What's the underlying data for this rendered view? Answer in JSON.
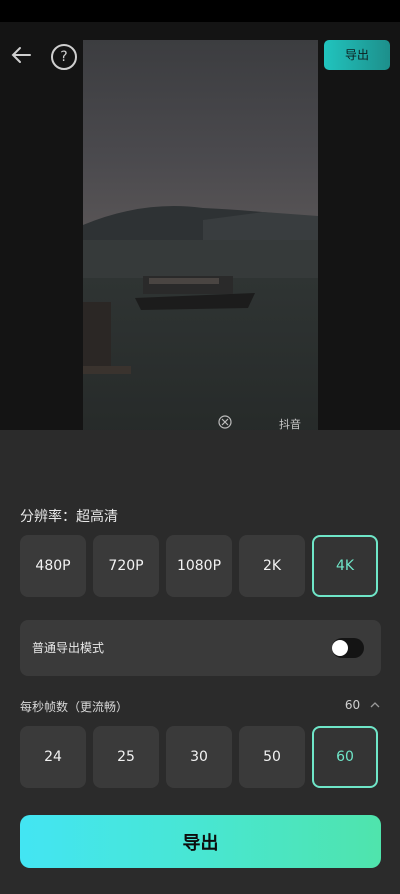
{
  "header": {
    "export_button_label": "导出",
    "back_icon": "arrow-left-icon",
    "help_icon": "question-circle-icon",
    "help_glyph": "?"
  },
  "preview": {
    "watermark_text": "抖音"
  },
  "resolution": {
    "label": "分辨率：超高清",
    "options": [
      "480P",
      "720P",
      "1080P",
      "2K",
      "4K"
    ],
    "selected": "4K"
  },
  "export_mode": {
    "label": "普通导出模式",
    "toggle_on": false
  },
  "frame_rate": {
    "label": "每秒帧数（更流畅）",
    "current_value": "60",
    "options": [
      "24",
      "25",
      "30",
      "50",
      "60"
    ],
    "selected": "60",
    "chevron_icon": "chevron-up-icon"
  },
  "footer": {
    "export_button_label": "导出"
  },
  "colors": {
    "accent": "#6fe6c8",
    "panel_bg": "#2b2b2b",
    "chip_bg": "#3a3a3a",
    "gradient_start": "#43e5f3",
    "gradient_end": "#4fe4ac"
  }
}
